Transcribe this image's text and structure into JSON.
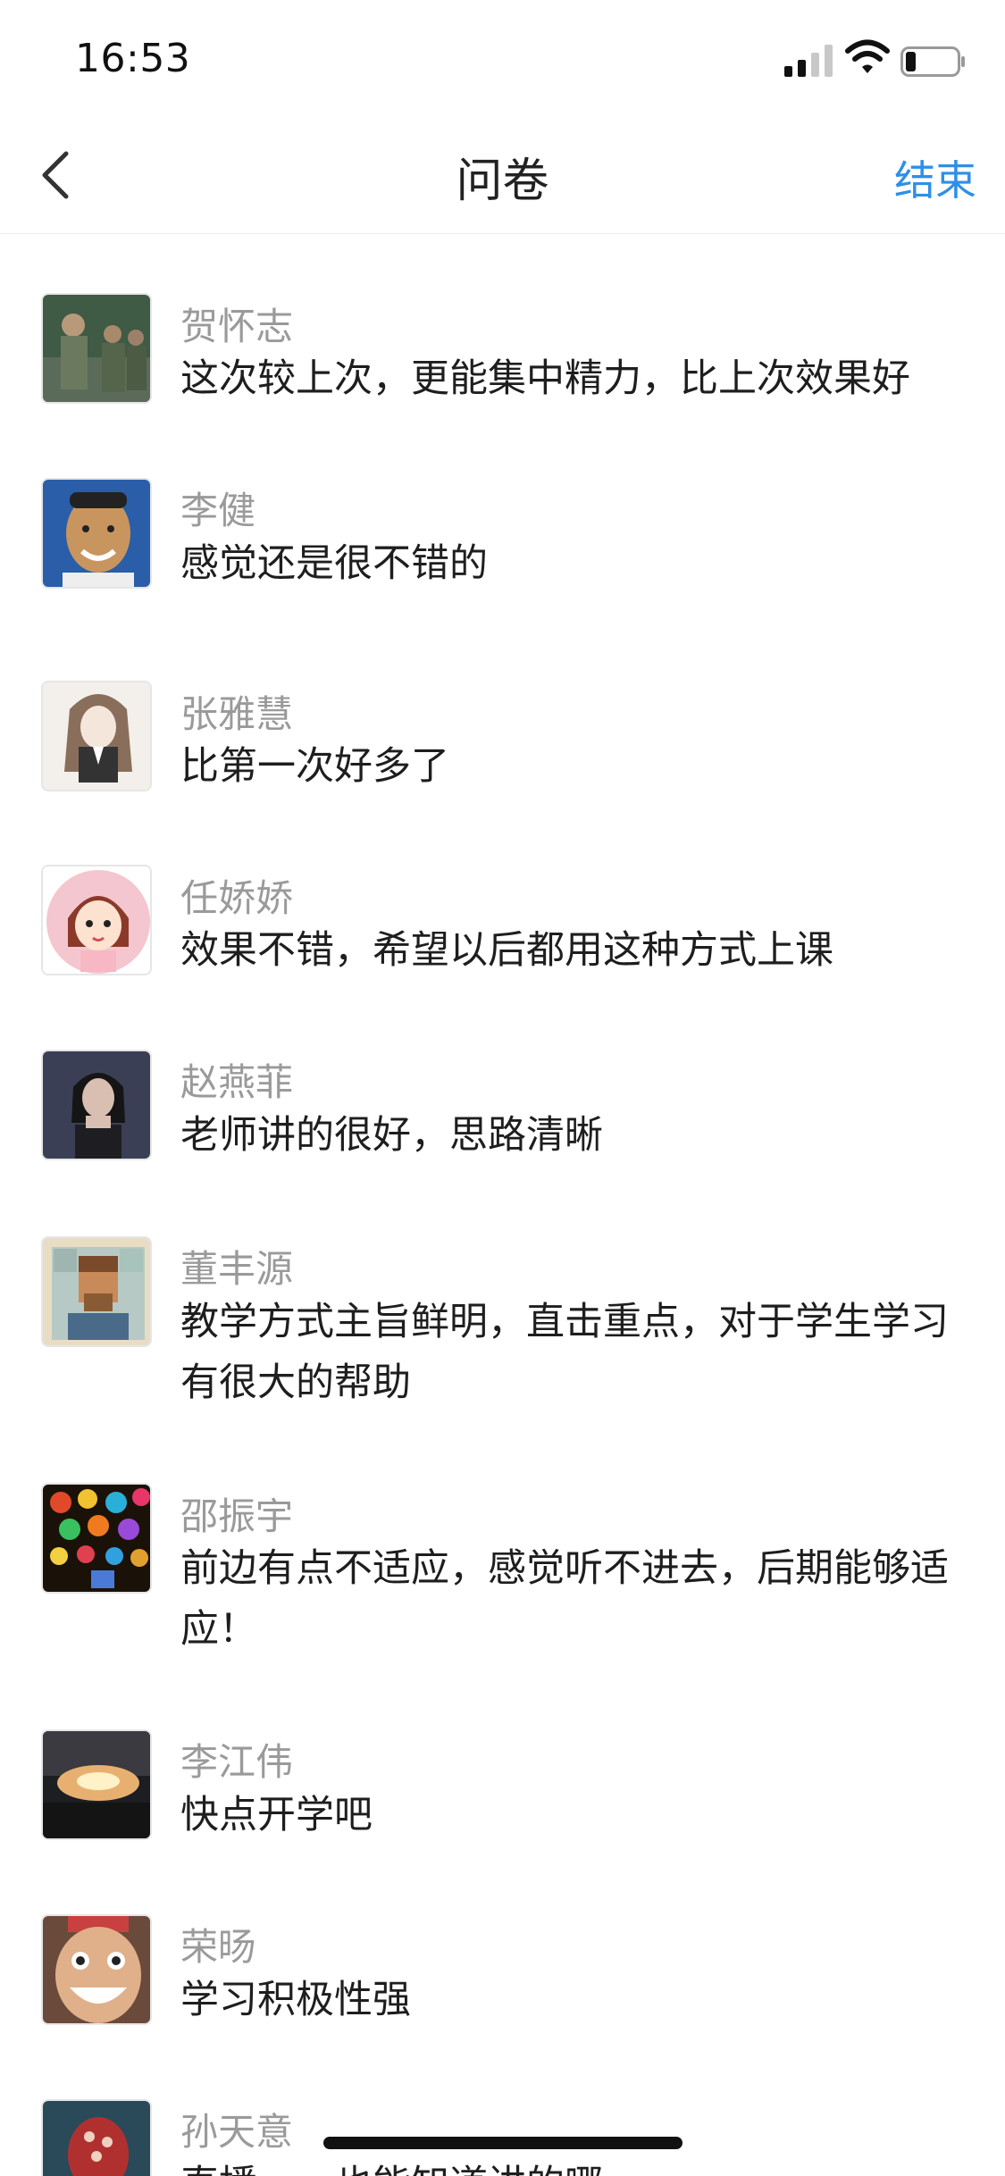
{
  "status_bar": {
    "time": "16:53"
  },
  "nav": {
    "title": "问卷",
    "end_label": "结束"
  },
  "responses": [
    {
      "name": "贺怀志",
      "comment": "这次较上次，更能集中精力，比上次效果好",
      "avatar": "avatar-soldiers-photo"
    },
    {
      "name": "李健",
      "comment": "感觉还是很不错的",
      "avatar": "avatar-man-smiling"
    },
    {
      "name": "张雅慧",
      "comment": "比第一次好多了",
      "avatar": "avatar-anime-girl-sketch"
    },
    {
      "name": "任娇娇",
      "comment": "效果不错，希望以后都用这种方式上课",
      "avatar": "avatar-cartoon-girl-pink"
    },
    {
      "name": "赵燕菲",
      "comment": "老师讲的很好，思路清晰",
      "avatar": "avatar-woman-dark"
    },
    {
      "name": "董丰源",
      "comment": "教学方式主旨鲜明，直击重点，对于学生学习有很大的帮助",
      "avatar": "avatar-pixel-portrait"
    },
    {
      "name": "邵振宇",
      "comment": "前边有点不适应，感觉听不进去，后期能够适应！",
      "avatar": "avatar-colorful-lanterns"
    },
    {
      "name": "李江伟",
      "comment": "快点开学吧",
      "avatar": "avatar-explosion-cloud"
    },
    {
      "name": "荣旸",
      "comment": "学习积极性强",
      "avatar": "avatar-funny-face"
    },
    {
      "name": "孙天意",
      "comment": "直播……也能知道讲的哪",
      "avatar": "avatar-red-head"
    }
  ],
  "colors": {
    "accent": "#2f8fe6",
    "name_gray": "#9a9a9a",
    "text": "#1e1e1e"
  }
}
